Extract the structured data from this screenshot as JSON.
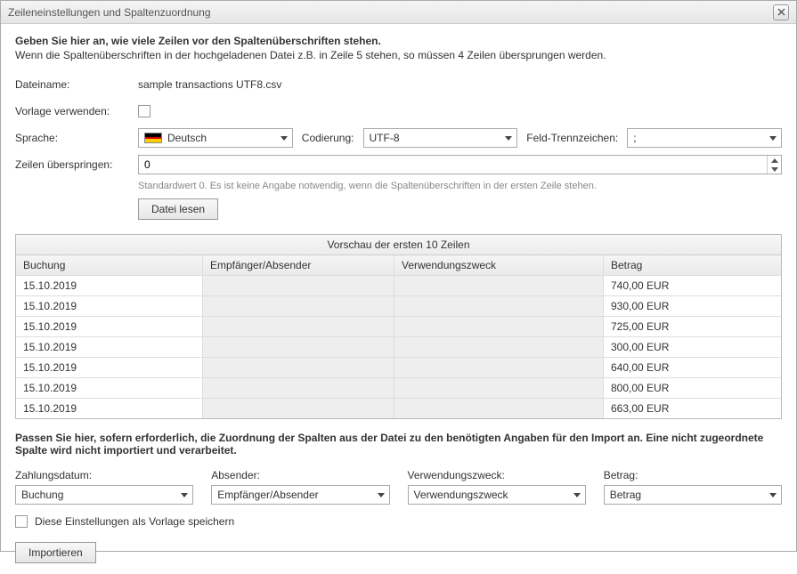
{
  "title": "Zeileneinstellungen und Spaltenzuordnung",
  "instr_bold": "Geben Sie hier an, wie viele Zeilen vor den Spaltenüberschriften stehen.",
  "instr_sub": "Wenn die Spaltenüberschriften in der hochgeladenen Datei z.B. in Zeile 5 stehen, so müssen 4 Zeilen übersprungen werden.",
  "labels": {
    "filename": "Dateiname:",
    "use_template": "Vorlage verwenden:",
    "language": "Sprache:",
    "encoding": "Codierung:",
    "separator": "Feld-Trennzeichen:",
    "skip_rows": "Zeilen überspringen:",
    "read_file": "Datei lesen",
    "preview_title": "Vorschau der ersten 10 Zeilen",
    "map_instr": "Passen Sie hier, sofern erforderlich, die Zuordnung der Spalten aus der Datei zu den benötigten Angaben für den Import an. Eine nicht zugeordnete Spalte wird nicht importiert und verarbeitet.",
    "map_date": "Zahlungsdatum:",
    "map_sender": "Absender:",
    "map_purpose": "Verwendungszweck:",
    "map_amount": "Betrag:",
    "save_template": "Diese Einstellungen als Vorlage speichern",
    "import": "Importieren"
  },
  "values": {
    "filename": "sample transactions UTF8.csv",
    "language": "Deutsch",
    "encoding": "UTF-8",
    "separator": ";",
    "skip_rows": "0",
    "skip_hint": "Standardwert 0. Es ist keine Angabe notwendig, wenn die Spaltenüberschriften in der ersten Zeile stehen.",
    "map_date": "Buchung",
    "map_sender": "Empfänger/Absender",
    "map_purpose": "Verwendungszweck",
    "map_amount": "Betrag"
  },
  "preview_cols": [
    "Buchung",
    "Empfänger/Absender",
    "Verwendungszweck",
    "Betrag"
  ],
  "preview_rows": [
    {
      "a": "15.10.2019",
      "b": "",
      "c": "",
      "d": "740,00 EUR"
    },
    {
      "a": "15.10.2019",
      "b": "",
      "c": "",
      "d": "930,00 EUR"
    },
    {
      "a": "15.10.2019",
      "b": "",
      "c": "",
      "d": "725,00 EUR"
    },
    {
      "a": "15.10.2019",
      "b": "",
      "c": "",
      "d": "300,00 EUR"
    },
    {
      "a": "15.10.2019",
      "b": "",
      "c": "",
      "d": "640,00 EUR"
    },
    {
      "a": "15.10.2019",
      "b": "",
      "c": "",
      "d": "800,00 EUR"
    },
    {
      "a": "15.10.2019",
      "b": "",
      "c": "",
      "d": "663,00 EUR"
    }
  ]
}
